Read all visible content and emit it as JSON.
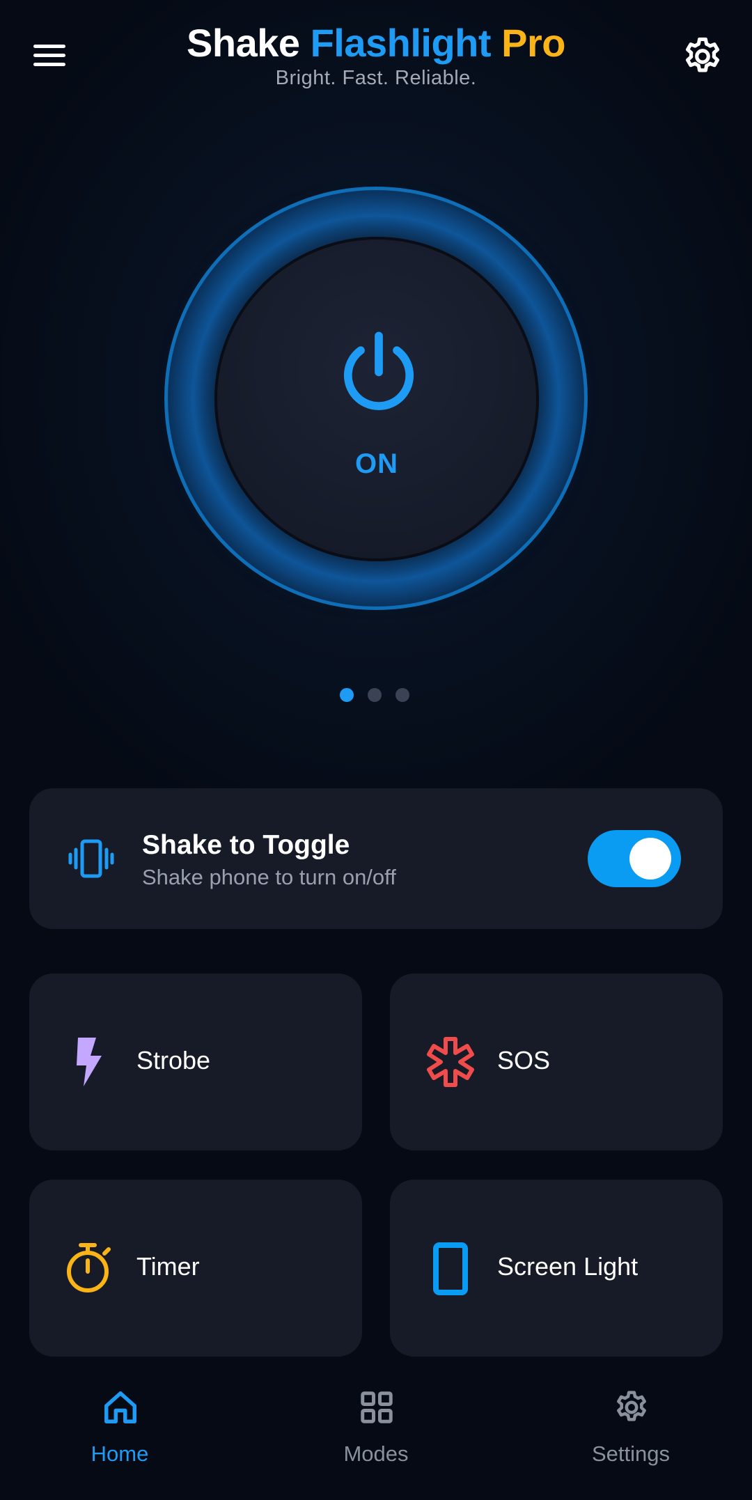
{
  "header": {
    "title_part1": "Shake",
    "title_part2": "Flashlight",
    "title_part3": "Pro",
    "subtitle": "Bright. Fast. Reliable.",
    "menu_icon": "hamburger-menu-icon",
    "settings_icon": "gear-icon"
  },
  "power": {
    "state_label": "ON",
    "icon": "power-icon"
  },
  "pager": {
    "pages": 3,
    "active_index": 0
  },
  "shake_toggle": {
    "title": "Shake to Toggle",
    "subtitle": "Shake phone to turn on/off",
    "icon": "vibrate-phone-icon",
    "enabled": true
  },
  "modes": [
    {
      "label": "Strobe",
      "icon": "lightning-bolt-icon",
      "color": "#c4a8ff"
    },
    {
      "label": "SOS",
      "icon": "medical-asterisk-icon",
      "color": "#f04c4c"
    },
    {
      "label": "Timer",
      "icon": "stopwatch-icon",
      "color": "#fbb417"
    },
    {
      "label": "Screen Light",
      "icon": "phone-screen-icon",
      "color": "#0a9bf3"
    }
  ],
  "bottom_nav": {
    "items": [
      {
        "label": "Home",
        "icon": "home-icon",
        "active": true
      },
      {
        "label": "Modes",
        "icon": "grid-icon",
        "active": false
      },
      {
        "label": "Settings",
        "icon": "gear-icon",
        "active": false
      }
    ]
  },
  "colors": {
    "accent": "#1e9cf5",
    "brand_gold": "#fbb417",
    "card_bg": "#171b27",
    "background": "#050a14"
  }
}
